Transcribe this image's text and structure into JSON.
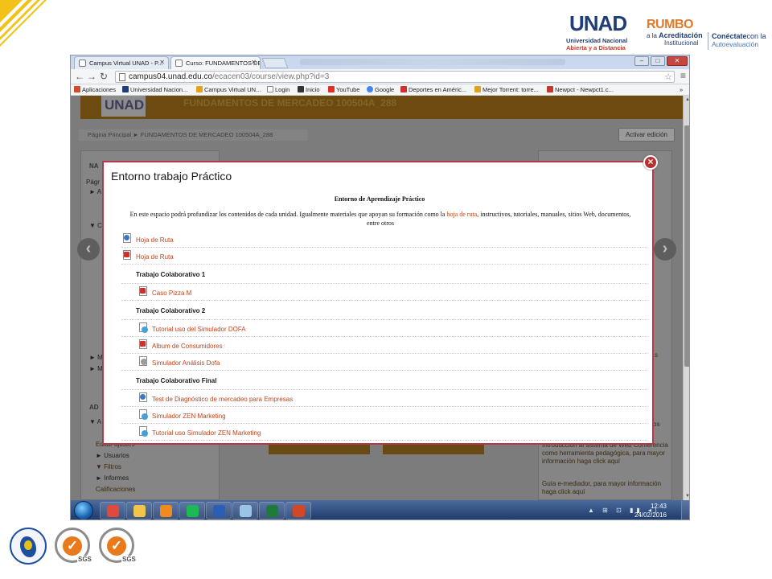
{
  "slide": {
    "logos": {
      "unad": {
        "word": "UNAD",
        "line1": "Universidad Nacional",
        "line2": "Abierta y a Distancia"
      },
      "rumbo": {
        "word": "RUMBO",
        "line1": "a la",
        "line1b": "Acreditación",
        "line2": "Institucional"
      },
      "conecta": {
        "a": "Conéctate",
        "a2": "con la",
        "b": "Autoevaluación"
      }
    },
    "certifications": {
      "sgs_label_1": "SGS",
      "sgs_label_2": "SGS"
    }
  },
  "browser": {
    "tabs": [
      {
        "label": "Campus Virtual UNAD - P...",
        "active": false
      },
      {
        "label": "Curso: FUNDAMENTOS DE...",
        "active": true
      }
    ],
    "window_controls": {
      "minimize": "–",
      "maximize": "□",
      "close": "✕"
    },
    "address": {
      "host": "campus04.unad.edu.co",
      "path": "/ecacen03/course/view.php?id=3"
    },
    "bookmarks": [
      {
        "label": "Aplicaciones",
        "color": "#d44a2a"
      },
      {
        "label": "Universidad Nacion...",
        "color": "#1f3e78"
      },
      {
        "label": "Campus Virtual UN...",
        "color": "#e5a21b"
      },
      {
        "label": "Login",
        "color": "#888888"
      },
      {
        "label": "Inicio",
        "color": "#333333"
      },
      {
        "label": "YouTube",
        "color": "#e52d27"
      },
      {
        "label": "Google",
        "color": "#4285f4"
      },
      {
        "label": "Deportes en Améric...",
        "color": "#d0312d"
      },
      {
        "label": "Mejor Torrent: torre...",
        "color": "#e0a020"
      },
      {
        "label": "Newpct - Newpct1.c...",
        "color": "#c0392b"
      }
    ],
    "bookmarks_more": "»"
  },
  "course_page": {
    "logo": "UNAD",
    "course_title": "FUNDAMENTOS DE MERCADEO 100504A_288",
    "breadcrumb": "Página Principal  ►  FUNDAMENTOS DE MERCADEO 100504A_288",
    "edit_button": "Activar edición",
    "left_nav_title": "NA",
    "left_nav_fragments": [
      "Págr",
      "► A",
      "▼ C",
      "► M",
      "► M"
    ],
    "admin_title": "AD",
    "admin_items": [
      "▼ A",
      "Editar ajustes",
      "► Usuarios",
      "▼ Filtros",
      "► Informes",
      "Calificaciones"
    ],
    "right_text_1": "s",
    "right_text_2": "os",
    "right_text_3": "Introducción al sistema de Web Conferencia como herramienta pedagógica, para mayor información haga click aquí",
    "right_text_4": "Guía e-mediador, para mayor información haga click aquí"
  },
  "modal": {
    "title": "Entorno trabajo Práctico",
    "heading": "Entorno de Aprendizaje Práctico",
    "intro_before": "En este  espacio podrá profundizar los contenidos de cada unidad.  Igualmente materiales que apoyan su formación como la ",
    "intro_link": "hoja de ruta",
    "intro_after": ", instructivos, tutoriales, manuales, sitios Web, documentos, entre otros",
    "close_glyph": "×",
    "items": [
      {
        "kind": "link",
        "indent": 0,
        "icon": "url",
        "label": "Hoja de Ruta"
      },
      {
        "kind": "link",
        "indent": 0,
        "icon": "pdf",
        "label": "Hoja de Ruta"
      },
      {
        "kind": "section",
        "label": "Trabajo Colaborativo 1"
      },
      {
        "kind": "link",
        "indent": 1,
        "icon": "pdf",
        "label": "Caso Pizza M"
      },
      {
        "kind": "section",
        "label": "Trabajo Colaborativo 2"
      },
      {
        "kind": "link",
        "indent": 1,
        "icon": "globe",
        "label": "Tutorial uso del Simulador DOFA"
      },
      {
        "kind": "link",
        "indent": 1,
        "icon": "pdf",
        "label": "Album de Consumidores"
      },
      {
        "kind": "link",
        "indent": 1,
        "icon": "gear",
        "label": "Simulador Análisis Dofa"
      },
      {
        "kind": "section",
        "label": "Trabajo Colaborativo Final"
      },
      {
        "kind": "link",
        "indent": 1,
        "icon": "url",
        "label": "Test de Diagnóstico de mercadeo para Empresas"
      },
      {
        "kind": "link",
        "indent": 1,
        "icon": "globe",
        "label": "Simulador ZEN Marketing"
      },
      {
        "kind": "link",
        "indent": 1,
        "icon": "globe",
        "label": "Tutorial uso Simulador ZEN Marketing"
      }
    ]
  },
  "taskbar": {
    "apps": [
      {
        "name": "chrome",
        "color": "#e0493b"
      },
      {
        "name": "explorer",
        "color": "#f0c64a"
      },
      {
        "name": "media-player",
        "color": "#f08a1c"
      },
      {
        "name": "spotify",
        "color": "#1db954"
      },
      {
        "name": "word",
        "color": "#2b5fb4"
      },
      {
        "name": "paint",
        "color": "#9ac3e6"
      },
      {
        "name": "excel",
        "color": "#1e7b3c"
      },
      {
        "name": "powerpoint",
        "color": "#d24726"
      }
    ],
    "tray_icons": "▲ ⊞ ⊡ ▮▮ ◂)",
    "time": "12:43",
    "date": "24/02/2016"
  }
}
